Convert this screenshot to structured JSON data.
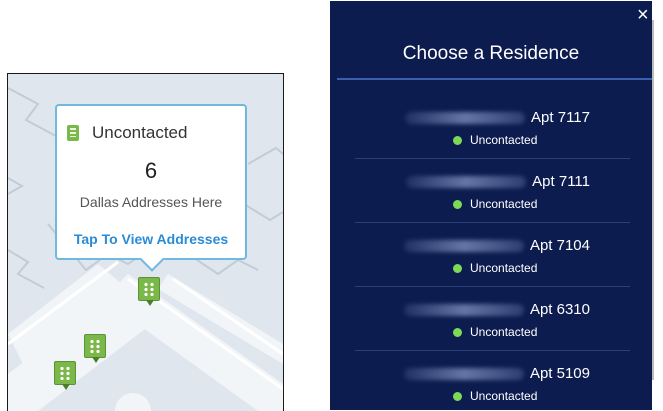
{
  "popup": {
    "status": "Uncontacted",
    "count": "6",
    "caption": "Dallas Addresses Here",
    "link": "Tap To View Addresses"
  },
  "modal": {
    "close": "×",
    "title": "Choose a Residence",
    "residences": [
      {
        "apt": "Apt 7117",
        "status": "Uncontacted"
      },
      {
        "apt": "Apt 7111",
        "status": "Uncontacted"
      },
      {
        "apt": "Apt 7104",
        "status": "Uncontacted"
      },
      {
        "apt": "Apt 6310",
        "status": "Uncontacted"
      },
      {
        "apt": "Apt 5109",
        "status": "Uncontacted"
      }
    ]
  },
  "colors": {
    "status_green": "#7ed957",
    "marker_green": "#7ab84a",
    "modal_bg": "#0d1c4f",
    "link_blue": "#2a8bd6"
  },
  "icons": [
    "building-icon",
    "close-icon",
    "status-dot-icon"
  ]
}
